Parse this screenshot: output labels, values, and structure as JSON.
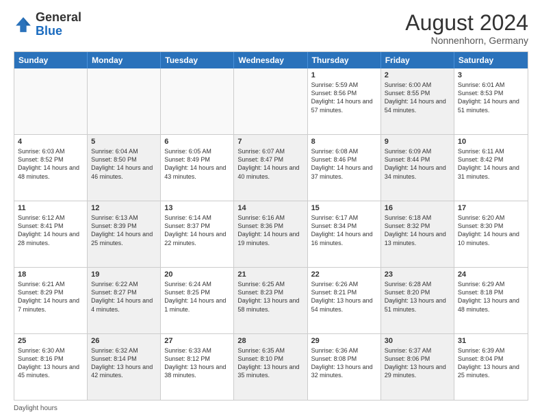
{
  "header": {
    "logo_general": "General",
    "logo_blue": "Blue",
    "month_year": "August 2024",
    "location": "Nonnenhorn, Germany"
  },
  "days_of_week": [
    "Sunday",
    "Monday",
    "Tuesday",
    "Wednesday",
    "Thursday",
    "Friday",
    "Saturday"
  ],
  "weeks": [
    [
      {
        "day": "",
        "info": "",
        "shaded": false,
        "empty": true
      },
      {
        "day": "",
        "info": "",
        "shaded": false,
        "empty": true
      },
      {
        "day": "",
        "info": "",
        "shaded": false,
        "empty": true
      },
      {
        "day": "",
        "info": "",
        "shaded": false,
        "empty": true
      },
      {
        "day": "1",
        "info": "Sunrise: 5:59 AM\nSunset: 8:56 PM\nDaylight: 14 hours and 57 minutes.",
        "shaded": false,
        "empty": false
      },
      {
        "day": "2",
        "info": "Sunrise: 6:00 AM\nSunset: 8:55 PM\nDaylight: 14 hours and 54 minutes.",
        "shaded": true,
        "empty": false
      },
      {
        "day": "3",
        "info": "Sunrise: 6:01 AM\nSunset: 8:53 PM\nDaylight: 14 hours and 51 minutes.",
        "shaded": false,
        "empty": false
      }
    ],
    [
      {
        "day": "4",
        "info": "Sunrise: 6:03 AM\nSunset: 8:52 PM\nDaylight: 14 hours and 48 minutes.",
        "shaded": false,
        "empty": false
      },
      {
        "day": "5",
        "info": "Sunrise: 6:04 AM\nSunset: 8:50 PM\nDaylight: 14 hours and 46 minutes.",
        "shaded": true,
        "empty": false
      },
      {
        "day": "6",
        "info": "Sunrise: 6:05 AM\nSunset: 8:49 PM\nDaylight: 14 hours and 43 minutes.",
        "shaded": false,
        "empty": false
      },
      {
        "day": "7",
        "info": "Sunrise: 6:07 AM\nSunset: 8:47 PM\nDaylight: 14 hours and 40 minutes.",
        "shaded": true,
        "empty": false
      },
      {
        "day": "8",
        "info": "Sunrise: 6:08 AM\nSunset: 8:46 PM\nDaylight: 14 hours and 37 minutes.",
        "shaded": false,
        "empty": false
      },
      {
        "day": "9",
        "info": "Sunrise: 6:09 AM\nSunset: 8:44 PM\nDaylight: 14 hours and 34 minutes.",
        "shaded": true,
        "empty": false
      },
      {
        "day": "10",
        "info": "Sunrise: 6:11 AM\nSunset: 8:42 PM\nDaylight: 14 hours and 31 minutes.",
        "shaded": false,
        "empty": false
      }
    ],
    [
      {
        "day": "11",
        "info": "Sunrise: 6:12 AM\nSunset: 8:41 PM\nDaylight: 14 hours and 28 minutes.",
        "shaded": false,
        "empty": false
      },
      {
        "day": "12",
        "info": "Sunrise: 6:13 AM\nSunset: 8:39 PM\nDaylight: 14 hours and 25 minutes.",
        "shaded": true,
        "empty": false
      },
      {
        "day": "13",
        "info": "Sunrise: 6:14 AM\nSunset: 8:37 PM\nDaylight: 14 hours and 22 minutes.",
        "shaded": false,
        "empty": false
      },
      {
        "day": "14",
        "info": "Sunrise: 6:16 AM\nSunset: 8:36 PM\nDaylight: 14 hours and 19 minutes.",
        "shaded": true,
        "empty": false
      },
      {
        "day": "15",
        "info": "Sunrise: 6:17 AM\nSunset: 8:34 PM\nDaylight: 14 hours and 16 minutes.",
        "shaded": false,
        "empty": false
      },
      {
        "day": "16",
        "info": "Sunrise: 6:18 AM\nSunset: 8:32 PM\nDaylight: 14 hours and 13 minutes.",
        "shaded": true,
        "empty": false
      },
      {
        "day": "17",
        "info": "Sunrise: 6:20 AM\nSunset: 8:30 PM\nDaylight: 14 hours and 10 minutes.",
        "shaded": false,
        "empty": false
      }
    ],
    [
      {
        "day": "18",
        "info": "Sunrise: 6:21 AM\nSunset: 8:29 PM\nDaylight: 14 hours and 7 minutes.",
        "shaded": false,
        "empty": false
      },
      {
        "day": "19",
        "info": "Sunrise: 6:22 AM\nSunset: 8:27 PM\nDaylight: 14 hours and 4 minutes.",
        "shaded": true,
        "empty": false
      },
      {
        "day": "20",
        "info": "Sunrise: 6:24 AM\nSunset: 8:25 PM\nDaylight: 14 hours and 1 minute.",
        "shaded": false,
        "empty": false
      },
      {
        "day": "21",
        "info": "Sunrise: 6:25 AM\nSunset: 8:23 PM\nDaylight: 13 hours and 58 minutes.",
        "shaded": true,
        "empty": false
      },
      {
        "day": "22",
        "info": "Sunrise: 6:26 AM\nSunset: 8:21 PM\nDaylight: 13 hours and 54 minutes.",
        "shaded": false,
        "empty": false
      },
      {
        "day": "23",
        "info": "Sunrise: 6:28 AM\nSunset: 8:20 PM\nDaylight: 13 hours and 51 minutes.",
        "shaded": true,
        "empty": false
      },
      {
        "day": "24",
        "info": "Sunrise: 6:29 AM\nSunset: 8:18 PM\nDaylight: 13 hours and 48 minutes.",
        "shaded": false,
        "empty": false
      }
    ],
    [
      {
        "day": "25",
        "info": "Sunrise: 6:30 AM\nSunset: 8:16 PM\nDaylight: 13 hours and 45 minutes.",
        "shaded": false,
        "empty": false
      },
      {
        "day": "26",
        "info": "Sunrise: 6:32 AM\nSunset: 8:14 PM\nDaylight: 13 hours and 42 minutes.",
        "shaded": true,
        "empty": false
      },
      {
        "day": "27",
        "info": "Sunrise: 6:33 AM\nSunset: 8:12 PM\nDaylight: 13 hours and 38 minutes.",
        "shaded": false,
        "empty": false
      },
      {
        "day": "28",
        "info": "Sunrise: 6:35 AM\nSunset: 8:10 PM\nDaylight: 13 hours and 35 minutes.",
        "shaded": true,
        "empty": false
      },
      {
        "day": "29",
        "info": "Sunrise: 6:36 AM\nSunset: 8:08 PM\nDaylight: 13 hours and 32 minutes.",
        "shaded": false,
        "empty": false
      },
      {
        "day": "30",
        "info": "Sunrise: 6:37 AM\nSunset: 8:06 PM\nDaylight: 13 hours and 29 minutes.",
        "shaded": true,
        "empty": false
      },
      {
        "day": "31",
        "info": "Sunrise: 6:39 AM\nSunset: 8:04 PM\nDaylight: 13 hours and 25 minutes.",
        "shaded": false,
        "empty": false
      }
    ]
  ],
  "footer": {
    "daylight_label": "Daylight hours"
  }
}
